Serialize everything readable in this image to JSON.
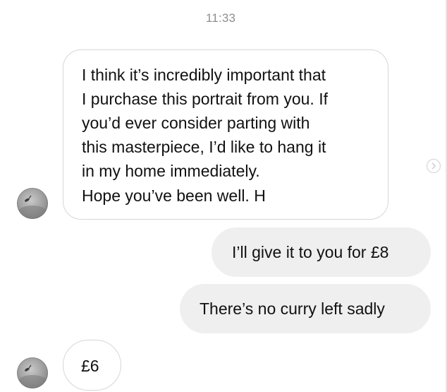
{
  "timestamp": "11:33",
  "messages": [
    {
      "from": "them",
      "lines": [
        "I think it’s incredibly important that",
        "I purchase this portrait from you. If",
        "you’d ever consider parting with",
        "this masterpiece, I’d like to hang it",
        "in my home immediately."
      ],
      "signoff": "Hope you’ve been well. H"
    },
    {
      "from": "me",
      "text": "I’ll give it to you for £8"
    },
    {
      "from": "me",
      "text": "There’s no curry left sadly"
    },
    {
      "from": "them",
      "text": "£6"
    }
  ],
  "icons": {
    "avatar": "avatar-photo",
    "message_action": "chevron-right-circle-icon"
  },
  "colors": {
    "incoming_bubble_border": "#d6d6d6",
    "outgoing_bubble_bg": "#efefef",
    "timestamp_text": "#8e8e8e",
    "message_text": "#111111"
  }
}
